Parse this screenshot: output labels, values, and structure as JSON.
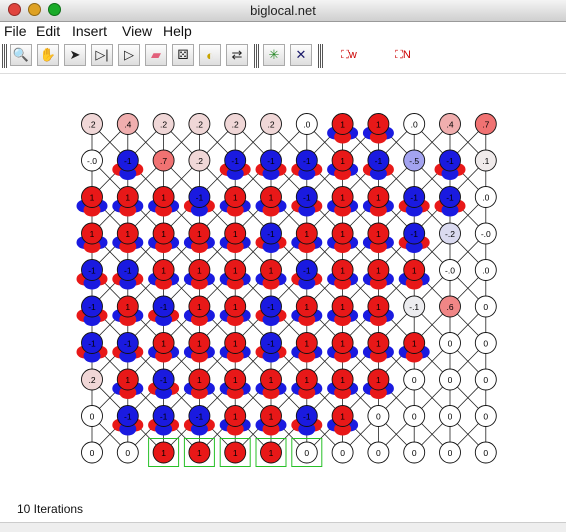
{
  "window": {
    "title": "biglocal.net"
  },
  "menu": [
    "File",
    "Edit",
    "Insert",
    "View",
    "Help"
  ],
  "toolbar": {
    "tools": [
      {
        "name": "zoom-tool-icon",
        "glyph": "🔍"
      },
      {
        "name": "hand-tool-icon",
        "glyph": "✋"
      },
      {
        "name": "arrow-tool-icon",
        "glyph": "➤"
      },
      {
        "name": "step-forward-icon",
        "glyph": "▷|"
      },
      {
        "name": "play-icon",
        "glyph": "▷"
      },
      {
        "name": "eraser-icon",
        "glyph": "▰"
      },
      {
        "name": "dice-icon",
        "glyph": "⚄"
      },
      {
        "name": "gauge-icon",
        "glyph": "◐"
      },
      {
        "name": "swap-arrows-icon",
        "glyph": "⇄"
      },
      {
        "name": "sparkle-node-icon",
        "glyph": "✳"
      },
      {
        "name": "crossed-node-icon",
        "glyph": "✕"
      },
      {
        "name": "node-w-icon",
        "glyph": "⛶w"
      },
      {
        "name": "node-n-icon",
        "glyph": "⛶N"
      }
    ]
  },
  "network": {
    "rows": [
      [
        ".2",
        ".4",
        ".2",
        ".2",
        ".2",
        ".2",
        ".0",
        "1",
        "1",
        ".0",
        ".4",
        ".7"
      ],
      [
        "-.0",
        "-1",
        ".7",
        ".2",
        "-1",
        "-1",
        "-1",
        "1",
        "-1",
        "-.5",
        "-1",
        ".1"
      ],
      [
        "1",
        "1",
        "1",
        "-1",
        "1",
        "1",
        "-1",
        "1",
        "1",
        "-1",
        "-1",
        ".0"
      ],
      [
        "1",
        "1",
        "1",
        "1",
        "1",
        "-1",
        "1",
        "1",
        "1",
        "-1",
        "-.2",
        "-.0"
      ],
      [
        "-1",
        "-1",
        "1",
        "1",
        "1",
        "1",
        "-1",
        "1",
        "1",
        "1",
        "-.0",
        ".0"
      ],
      [
        "-1",
        "1",
        "-1",
        "1",
        "1",
        "-1",
        "1",
        "1",
        "1",
        "-.1",
        ".6",
        "0"
      ],
      [
        "-1",
        "-1",
        "1",
        "1",
        "1",
        "-1",
        "1",
        "1",
        "1",
        "1",
        "0",
        "0"
      ],
      [
        ".2",
        "1",
        "-1",
        "1",
        "1",
        "1",
        "1",
        "1",
        "1",
        "0",
        "0",
        "0"
      ],
      [
        "0",
        "-1",
        "-1",
        "-1",
        "1",
        "1",
        "-1",
        "1",
        "0",
        "0",
        "0",
        "0"
      ],
      [
        "0",
        "0",
        "1",
        "1",
        "1",
        "1",
        "0",
        "0",
        "0",
        "0",
        "0",
        "0"
      ]
    ],
    "clamped_row": 9,
    "clamped_cols": [
      2,
      3,
      4,
      5,
      6
    ]
  },
  "status": {
    "text": "10 Iterations"
  }
}
